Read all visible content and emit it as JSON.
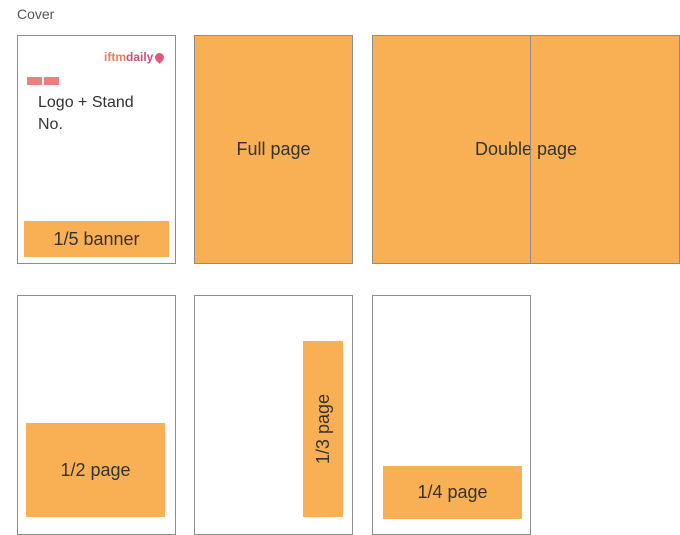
{
  "heading": "Cover",
  "cover": {
    "brand_part1": "iftm",
    "brand_part2": "daily",
    "logo_text": "Logo + Stand No.",
    "banner_label": "1/5 banner"
  },
  "full_page": {
    "label": "Full page"
  },
  "double_page": {
    "label": "Double page"
  },
  "half_page": {
    "label": "1/2 page"
  },
  "third_page": {
    "label": "1/3 page"
  },
  "quarter_page": {
    "label": "1/4 page"
  },
  "colors": {
    "ad_fill": "#f9b054",
    "border": "#8d8d8d",
    "brand_pink": "#e8567c"
  }
}
